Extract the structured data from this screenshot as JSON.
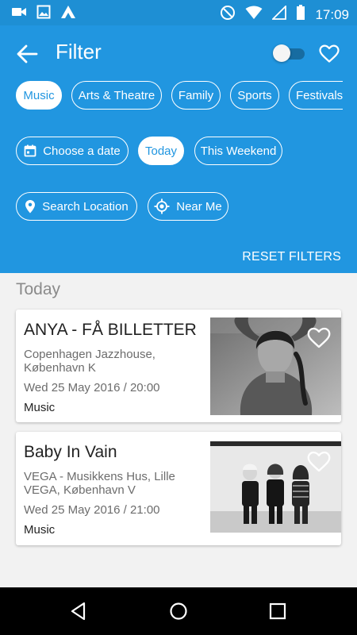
{
  "status_bar": {
    "time": "17:09",
    "left_icons": [
      "video-icon",
      "image-icon",
      "app-icon"
    ],
    "right_icons": [
      "do-not-disturb-icon",
      "wifi-icon",
      "signal-icon",
      "battery-icon"
    ]
  },
  "header": {
    "title": "Filter",
    "back_icon": "arrow-left-icon",
    "favorite_icon": "heart-outline-icon",
    "toggle_on": false
  },
  "categories": [
    {
      "label": "Music",
      "active": true
    },
    {
      "label": "Arts & Theatre",
      "active": false
    },
    {
      "label": "Family",
      "active": false
    },
    {
      "label": "Sports",
      "active": false
    },
    {
      "label": "Festivals",
      "active": false
    }
  ],
  "date_filters": [
    {
      "label": "Choose a date",
      "icon": "calendar-icon",
      "active": false
    },
    {
      "label": "Today",
      "active": true
    },
    {
      "label": "This Weekend",
      "active": false
    }
  ],
  "location_filters": [
    {
      "label": "Search Location",
      "icon": "location-pin-icon"
    },
    {
      "label": "Near Me",
      "icon": "gps-target-icon"
    }
  ],
  "reset_label": "RESET FILTERS",
  "section_title": "Today",
  "events": [
    {
      "name": "ANYA - FÅ BILLETTER",
      "venue": "Copenhagen Jazzhouse, København K",
      "date": "Wed 25 May 2016 / 20:00",
      "category": "Music"
    },
    {
      "name": "Baby In Vain",
      "venue": "VEGA - Musikkens Hus, Lille VEGA, København V",
      "date": "Wed 25 May 2016 / 21:00",
      "category": "Music"
    }
  ],
  "nav": [
    "back-triangle-icon",
    "home-circle-icon",
    "recents-square-icon"
  ],
  "colors": {
    "accent": "#2196e0",
    "status_bar": "#1e8fd4",
    "background": "#f2f2f2",
    "nav_bar": "#000000"
  }
}
